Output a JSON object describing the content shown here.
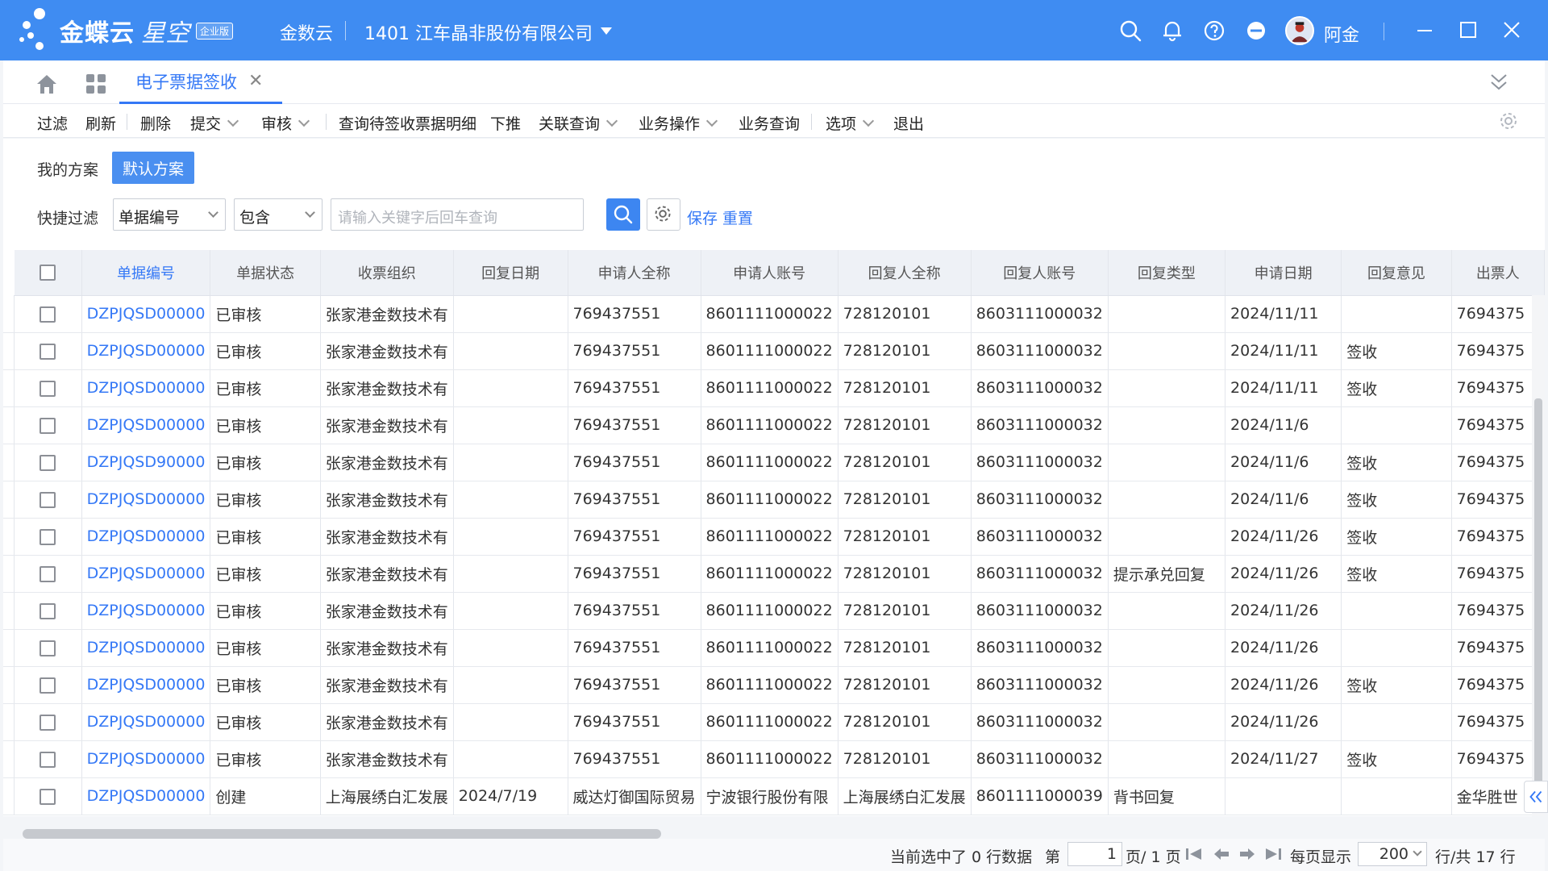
{
  "topbar": {
    "logo_text": "金蝶云",
    "logo_text_2": "星空",
    "logo_badge": "企业版",
    "tenant": "金数云",
    "org": "1401  江车晶非股份有限公司",
    "username": "阿金",
    "icons": [
      "search-icon",
      "bell-icon",
      "help-icon",
      "minus-circle-icon",
      "avatar",
      "minimize-icon",
      "maximize-icon",
      "close-icon"
    ],
    "accent": "#3f8cf2"
  },
  "tabs": {
    "active_label": "电子票据签收"
  },
  "toolbar": {
    "items": [
      "过滤",
      "刷新",
      "删除",
      "提交",
      "审核",
      "查询待签收票据明细",
      "下推",
      "关联查询",
      "业务操作",
      "业务查询",
      "选项",
      "退出"
    ]
  },
  "filter": {
    "plan_label": "我的方案",
    "plan_default": "默认方案",
    "quick_label": "快捷过滤",
    "field_select": "单据编号",
    "op_select": "包含",
    "search_placeholder": "请输入关键字后回车查询",
    "save": "保存",
    "reset": "重置"
  },
  "grid": {
    "columns": [
      "单据编号",
      "单据状态",
      "收票组织",
      "回复日期",
      "申请人全称",
      "申请人账号",
      "回复人全称",
      "回复人账号",
      "回复类型",
      "申请日期",
      "回复意见",
      "出票人"
    ],
    "rows": [
      [
        "DZPJQSD00000",
        "已审核",
        "张家港金数技术有",
        "",
        "769437551",
        "8601111000022",
        "728120101",
        "8603111000032",
        "",
        "2024/11/11",
        "",
        "7694375"
      ],
      [
        "DZPJQSD00000",
        "已审核",
        "张家港金数技术有",
        "",
        "769437551",
        "8601111000022",
        "728120101",
        "8603111000032",
        "",
        "2024/11/11",
        "签收",
        "7694375"
      ],
      [
        "DZPJQSD00000",
        "已审核",
        "张家港金数技术有",
        "",
        "769437551",
        "8601111000022",
        "728120101",
        "8603111000032",
        "",
        "2024/11/11",
        "签收",
        "7694375"
      ],
      [
        "DZPJQSD00000",
        "已审核",
        "张家港金数技术有",
        "",
        "769437551",
        "8601111000022",
        "728120101",
        "8603111000032",
        "",
        "2024/11/6",
        "",
        "7694375"
      ],
      [
        "DZPJQSD90000",
        "已审核",
        "张家港金数技术有",
        "",
        "769437551",
        "8601111000022",
        "728120101",
        "8603111000032",
        "",
        "2024/11/6",
        "签收",
        "7694375"
      ],
      [
        "DZPJQSD00000",
        "已审核",
        "张家港金数技术有",
        "",
        "769437551",
        "8601111000022",
        "728120101",
        "8603111000032",
        "",
        "2024/11/6",
        "签收",
        "7694375"
      ],
      [
        "DZPJQSD00000",
        "已审核",
        "张家港金数技术有",
        "",
        "769437551",
        "8601111000022",
        "728120101",
        "8603111000032",
        "",
        "2024/11/26",
        "签收",
        "7694375"
      ],
      [
        "DZPJQSD00000",
        "已审核",
        "张家港金数技术有",
        "",
        "769437551",
        "8601111000022",
        "728120101",
        "8603111000032",
        "提示承兑回复",
        "2024/11/26",
        "签收",
        "7694375"
      ],
      [
        "DZPJQSD00000",
        "已审核",
        "张家港金数技术有",
        "",
        "769437551",
        "8601111000022",
        "728120101",
        "8603111000032",
        "",
        "2024/11/26",
        "",
        "7694375"
      ],
      [
        "DZPJQSD00000",
        "已审核",
        "张家港金数技术有",
        "",
        "769437551",
        "8601111000022",
        "728120101",
        "8603111000032",
        "",
        "2024/11/26",
        "",
        "7694375"
      ],
      [
        "DZPJQSD00000",
        "已审核",
        "张家港金数技术有",
        "",
        "769437551",
        "8601111000022",
        "728120101",
        "8603111000032",
        "",
        "2024/11/26",
        "签收",
        "7694375"
      ],
      [
        "DZPJQSD00000",
        "已审核",
        "张家港金数技术有",
        "",
        "769437551",
        "8601111000022",
        "728120101",
        "8603111000032",
        "",
        "2024/11/26",
        "",
        "7694375"
      ],
      [
        "DZPJQSD00000",
        "已审核",
        "张家港金数技术有",
        "",
        "769437551",
        "8601111000022",
        "728120101",
        "8603111000032",
        "",
        "2024/11/27",
        "签收",
        "7694375"
      ],
      [
        "DZPJQSD00000",
        "创建",
        "上海展绣白汇发展",
        "2024/7/19",
        "威达灯御国际贸易",
        "宁波银行股份有限",
        "上海展绣白汇发展",
        "8601111000039",
        "背书回复",
        "",
        "",
        "金华胜世"
      ]
    ]
  },
  "footer": {
    "selected_text": "当前选中了 0 行数据",
    "page_prefix": "第",
    "page_value": "1",
    "page_suffix": "页/ 1 页",
    "per_page_label": "每页显示",
    "per_page_value": "200",
    "total_text": "行/共 17 行"
  }
}
